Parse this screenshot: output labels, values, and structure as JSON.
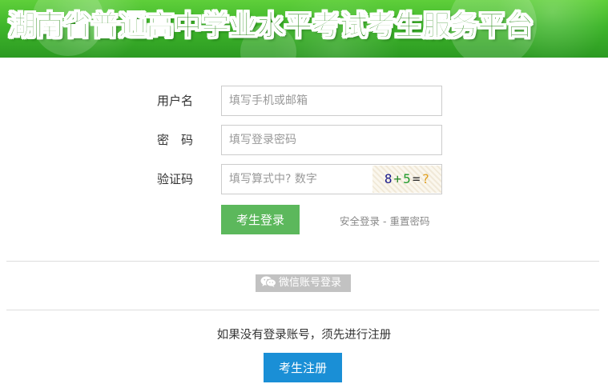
{
  "header": {
    "title": "湖南省普通高中学业水平考试考生服务平台"
  },
  "login_form": {
    "username": {
      "label": "用户名",
      "value": "",
      "placeholder": "填写手机或邮箱"
    },
    "password": {
      "label": "密　码",
      "value": "",
      "placeholder": "填写登录密码"
    },
    "captcha": {
      "label": "验证码",
      "value": "",
      "placeholder": "填写算式中? 数字",
      "image_chars": [
        "8",
        "+",
        "5",
        "=",
        "?"
      ],
      "image_colors": [
        "#1a1a8c",
        "#2e8b2e",
        "#1f9a2a",
        "#2c2c2c",
        "#e0a020"
      ]
    },
    "login_button": "考生登录",
    "secure_login_link": "安全登录",
    "link_separator": "-",
    "reset_password_link": "重置密码"
  },
  "wechat_login": {
    "label": "微信账号登录",
    "icon": "wechat-icon"
  },
  "registration": {
    "note": "如果没有登录账号，须先进行注册",
    "register_button": "考生注册"
  },
  "colors": {
    "banner_green": "#3fb62b",
    "login_button": "#5cb85c",
    "register_button": "#1a8fd6",
    "wechat_button": "#c2c2c2"
  }
}
